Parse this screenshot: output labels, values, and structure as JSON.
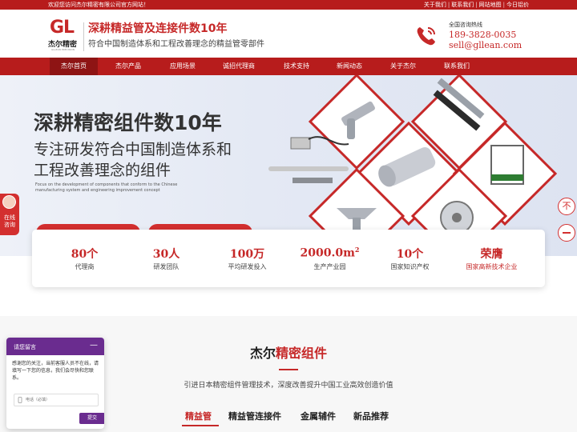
{
  "topbar": {
    "welcome": "欢迎您访问杰尔精密有限公司官方网站！",
    "links": [
      "关于我们",
      "联系我们",
      "网站地图",
      "今日铝价"
    ]
  },
  "header": {
    "logo_mark": "GL",
    "logo_name": "杰尔精密",
    "logo_sub": "GLLEAN PRECISION",
    "slogan_title": "深耕精益管及连接件数10年",
    "slogan_sub": "符合中国制造体系和工程改善理念的精益管零部件",
    "hotline_label": "全国咨询热线",
    "hotline_phone": "189-3828-0035",
    "hotline_email": "sell@gllean.com"
  },
  "nav": {
    "items": [
      "杰尔首页",
      "杰尔产品",
      "应用场景",
      "诚招代理商",
      "技术支持",
      "新闻动态",
      "关于杰尔",
      "联系我们"
    ],
    "active_index": 0
  },
  "hero": {
    "line1": "深耕精密组件数10年",
    "line2": "专注研发符合中国制造体系和",
    "line3": "工程改善理念的组件",
    "en": "Focus on the development of components that conform to the Chinese manufacturing system and engineering improvement concept"
  },
  "side_chat": {
    "label": "在线咨询"
  },
  "float_buttons": {
    "top": "不"
  },
  "stats": [
    {
      "num": "80个",
      "label": "代理商"
    },
    {
      "num": "30人",
      "label": "研发团队"
    },
    {
      "num": "100万",
      "label": "平均研发投入"
    },
    {
      "num": "2000.0m",
      "sup": "2",
      "label": "生产产业园"
    },
    {
      "num": "10个",
      "label": "国家知识产权"
    },
    {
      "num": "荣膺",
      "label": "国家高新技术企业"
    }
  ],
  "section": {
    "title_a": "杰尔",
    "title_b": "精密组件",
    "subtitle": "引进日本精密组件管理技术，深度改善提升中国工业高效创造价值",
    "tabs": [
      "精益管",
      "精益管连接件",
      "金属辅件",
      "新品推荐"
    ],
    "active_tab": 0
  },
  "message": {
    "title": "请您留言",
    "body": "感谢您的关注，当前客服人员不在线，请填写一下您的信息，我们会尽快和您联系。",
    "placeholder": "电话（必填）",
    "submit": "提交"
  },
  "colors": {
    "brand_red": "#c62828",
    "nav_red": "#b71c1c",
    "widget_purple": "#6a2c8f"
  }
}
